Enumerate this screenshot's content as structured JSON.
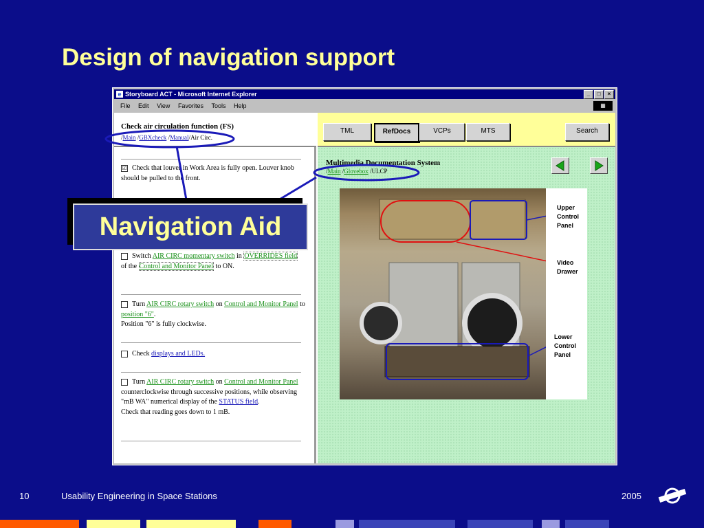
{
  "slide": {
    "title": "Design of navigation support",
    "callout": "Navigation Aid",
    "footer": {
      "page": "10",
      "text": "Usability Engineering in Space Stations",
      "year": "2005",
      "logo": "TNO"
    }
  },
  "browser": {
    "title": "Storyboard ACT - Microsoft Internet Explorer",
    "window_buttons": [
      "_",
      "□",
      "×"
    ],
    "menu": [
      "File",
      "Edit",
      "View",
      "Favorites",
      "Tools",
      "Help"
    ]
  },
  "left": {
    "heading": "Check air circulation function (FS)",
    "breadcrumb": {
      "sep": "/",
      "items": [
        "Main",
        "GBXcheck",
        "Manual"
      ],
      "current": "Air Circ."
    },
    "steps": {
      "s1": {
        "check": "☑",
        "text": "Check that louver in Work Area is fully open. Louver knob should be pulled to the front."
      },
      "s2": {
        "pre": "Switch ",
        "link1": "AIR CIRC momentary switch",
        "mid1": " in ",
        "link2": "OVERRIDES field",
        "mid2": " of the ",
        "link3": "Control and Monitor Panel",
        "post": " to ON."
      },
      "s3": {
        "pre": "Turn ",
        "link1": "AIR CIRC rotary switch",
        "mid1": " on ",
        "link2": "Control and Monitor Panel",
        "mid2": " to ",
        "link3": "position \"6\"",
        "post": ".",
        "note": "Position \"6\" is fully clockwise."
      },
      "s4": {
        "pre": "Check ",
        "link1": "displays and LEDs."
      },
      "s5": {
        "pre": "Turn ",
        "link1": "AIR CIRC rotary switch",
        "mid1": " on ",
        "link2": "Control and Monitor Panel",
        "mid2": " counterclockwise through successive positions, while observing \"mB WA\" numerical display of the ",
        "link3": "STATUS field",
        "post": ".",
        "note": "Check that reading goes down to 1 mB."
      }
    }
  },
  "right": {
    "tabs": [
      "TML",
      "RefDocs",
      "VCPs",
      "MTS"
    ],
    "search_label": "Search",
    "heading": "Multimedia Documentation System",
    "breadcrumb": {
      "items": [
        "Main",
        "Glovebox"
      ],
      "current": "ULCP"
    },
    "photo_labels": {
      "upper": "Upper Control Panel",
      "video": "Video Drawer",
      "lower": "Lower Control Panel"
    }
  },
  "colors": {
    "slide_bg": "#0b0d8a",
    "title": "#ffff99",
    "annotation_blue": "#1a1ab8",
    "annotation_red": "#e01010"
  }
}
